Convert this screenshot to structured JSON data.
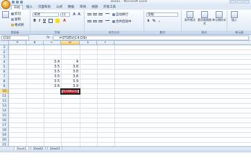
{
  "window": {
    "title": "Book1 - Microsoft Excel"
  },
  "ribbon_tabs": [
    {
      "label": "开始",
      "active": true
    },
    {
      "label": "插入",
      "active": false
    },
    {
      "label": "页面布局",
      "active": false
    },
    {
      "label": "公式",
      "active": false
    },
    {
      "label": "数据",
      "active": false
    },
    {
      "label": "审阅",
      "active": false
    },
    {
      "label": "视图",
      "active": false
    },
    {
      "label": "开发工具",
      "active": false
    }
  ],
  "clipboard": {
    "cut": "剪切",
    "copy": "复制",
    "format_painter": "格式刷",
    "group": "剪贴板"
  },
  "font": {
    "name": "宋体",
    "size": "11",
    "bold": "B",
    "italic": "I",
    "underline": "U",
    "group": "字体"
  },
  "alignment": {
    "wrap_text": "自动换行",
    "merge_center": "合并后居中",
    "group": "对齐方式"
  },
  "number": {
    "format": "常规",
    "group": "数字"
  },
  "styles": {
    "conditional": "条件格式",
    "table_format": "套用表格格式",
    "cell_styles": "单元格样式",
    "group": "样式"
  },
  "cells": {
    "insert": "插入",
    "group": "单元格"
  },
  "formula_bar": {
    "name_box": "D10",
    "fx": "fx",
    "formula": "=STDEV(C4:D9)"
  },
  "columns": [
    "A",
    "B",
    "C",
    "D",
    "E",
    "F"
  ],
  "rows": [
    "1",
    "2",
    "3",
    "4",
    "5",
    "6",
    "7",
    "8",
    "9",
    "10",
    "11",
    "12",
    "13",
    "14",
    "15",
    "16",
    "17",
    "18",
    "19",
    "20",
    "21"
  ],
  "cell_values": {
    "C4": "3.4",
    "D4": "4",
    "C5": "3.5",
    "D5": "3.8",
    "C6": "3.5",
    "D6": "3.8",
    "C7": "3.5",
    "D7": "3.8",
    "C8": "3.5",
    "D8": "3.9",
    "C9": "3.6",
    "D9": "3.9",
    "D10": "0.166211"
  },
  "sheets": [
    "Sheet1",
    "Sheet2",
    "Sheet3"
  ],
  "colors": {
    "highlight": "#c0333d",
    "ribbon": "#dde8f5"
  }
}
